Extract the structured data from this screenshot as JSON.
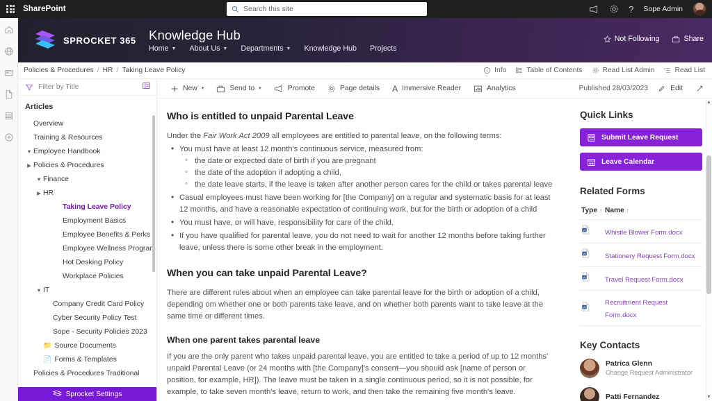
{
  "suitebar": {
    "app_name": "SharePoint",
    "search_placeholder": "Search this site",
    "user_name": "Sope Admin",
    "icons": [
      "waffle-icon",
      "megaphone-icon",
      "gear-icon",
      "help-icon",
      "avatar"
    ]
  },
  "rail": {
    "items": [
      {
        "name": "home-icon"
      },
      {
        "name": "globe-icon"
      },
      {
        "name": "news-icon"
      },
      {
        "name": "page-icon"
      },
      {
        "name": "list-icon"
      },
      {
        "name": "create-icon"
      }
    ]
  },
  "site_header": {
    "logo_text": "SPROCKET 365",
    "site_title": "Knowledge Hub",
    "nav": [
      {
        "label": "Home",
        "has_chevron": true
      },
      {
        "label": "About Us",
        "has_chevron": true
      },
      {
        "label": "Departments",
        "has_chevron": true
      },
      {
        "label": "Knowledge Hub",
        "has_chevron": false
      },
      {
        "label": "Projects",
        "has_chevron": false
      }
    ],
    "follow_label": "Not Following",
    "share_label": "Share"
  },
  "breadcrumb": {
    "items": [
      "Policies & Procedures",
      "HR",
      "Taking Leave Policy"
    ],
    "separator": "/",
    "right_commands": [
      {
        "label": "Info",
        "icon": "info-icon"
      },
      {
        "label": "Table of Contents",
        "icon": "toc-icon"
      },
      {
        "label": "Read List Admin",
        "icon": "gear-icon"
      },
      {
        "label": "Read List",
        "icon": "readlist-icon"
      }
    ]
  },
  "leftnav": {
    "filter_placeholder": "Filter by Title",
    "section_title": "Articles",
    "items": [
      {
        "label": "Overview",
        "indent": 1,
        "twisty": "",
        "selected": false
      },
      {
        "label": "Training & Resources",
        "indent": 1,
        "twisty": "",
        "selected": false
      },
      {
        "label": "Employee Handbook",
        "indent": 1,
        "twisty": "v",
        "selected": false
      },
      {
        "label": "Policies & Procedures",
        "indent": 1,
        "twisty": ">",
        "selected": false
      },
      {
        "label": "Finance",
        "indent": 2,
        "twisty": "v",
        "selected": false
      },
      {
        "label": "HR",
        "indent": 2,
        "twisty": ">",
        "selected": false
      },
      {
        "label": "Taking Leave Policy",
        "indent": 4,
        "twisty": "",
        "selected": true
      },
      {
        "label": "Employment Basics",
        "indent": 4,
        "twisty": "",
        "selected": false
      },
      {
        "label": "Employee Benefits & Perks",
        "indent": 4,
        "twisty": "",
        "selected": false
      },
      {
        "label": "Employee Wellness Program",
        "indent": 4,
        "twisty": "",
        "selected": false
      },
      {
        "label": "Hot Desking Policy",
        "indent": 4,
        "twisty": "",
        "selected": false
      },
      {
        "label": "Workplace Policies",
        "indent": 4,
        "twisty": "",
        "selected": false
      },
      {
        "label": "IT",
        "indent": 2,
        "twisty": "v",
        "selected": false
      },
      {
        "label": "Company Credit Card Policy",
        "indent": 3,
        "twisty": "",
        "selected": false
      },
      {
        "label": "Cyber Security Policy Test",
        "indent": 3,
        "twisty": "",
        "selected": false
      },
      {
        "label": "Sope - Security Policies 2023",
        "indent": 3,
        "twisty": "",
        "selected": false
      },
      {
        "label": "Source Documents",
        "indent": 2,
        "twisty": "",
        "selected": false,
        "emoji": "folder"
      },
      {
        "label": "Forms & Templates",
        "indent": 2,
        "twisty": "",
        "selected": false,
        "emoji": "doclib"
      },
      {
        "label": "Policies & Procedures Traditional",
        "indent": 1,
        "twisty": "",
        "selected": false
      }
    ],
    "footer_label": "Sprocket Settings"
  },
  "commandbar": {
    "commands": [
      {
        "label": "New",
        "icon": "plus-icon",
        "chevron": true
      },
      {
        "label": "Send to",
        "icon": "sendto-icon",
        "chevron": true
      },
      {
        "label": "Promote",
        "icon": "megaphone-icon",
        "chevron": false
      },
      {
        "label": "Page details",
        "icon": "gear-icon",
        "chevron": false
      },
      {
        "label": "Immersive Reader",
        "icon": "immersive-reader-icon",
        "chevron": false
      },
      {
        "label": "Analytics",
        "icon": "analytics-icon",
        "chevron": false
      }
    ],
    "published_label": "Published 28/03/2023",
    "edit_label": "Edit",
    "expand_icon": "expand-icon"
  },
  "article": {
    "heading1": "Who is entitled to unpaid Parental Leave",
    "intro_before": "Under the ",
    "intro_italic": "Fair Work Act 2009",
    "intro_after": " all employees are entitled to parental leave, on the following terms:",
    "bullet1": "You must have at least 12 month's continuous service, measured from:",
    "sub_bullets": [
      "the date or expected date of birth if you are pregnant",
      "the date of the adoption if adopting a child,",
      "the date leave starts, if the leave is taken after another person cares for the child or takes parental leave"
    ],
    "bullets_rest": [
      "Casual employees must have been working for [the Company] on a regular and systematic basis for at least 12 months, and have a reasonable expectation of continuing work, but for the birth or adoption of a child",
      "You must have, or will have, responsibility for care of the child.",
      "If you have qualified for parental leave, you do not need to wait for another 12 months before taking further leave, unless there is some other break in the employment."
    ],
    "heading2": "When you can take unpaid Parental Leave?",
    "para2": "There are different rules about when an employee can take parental leave for the birth or adoption of a child, depending om whether one or both parents take leave, and on whether both parents want to take leave at the same time or different times.",
    "heading3": "When one parent takes parental leave",
    "para3": "If you are the only parent who takes unpaid parental leave, you are entitled to take a period of up to 12 months' unpaid Parental Leave (or 24 months with [the Company]'s consent—you should ask [name of person or position, for example, HR]). The leave must be taken in a single continuous period, so it is not possible, for example, to take seven month's leave, return to work, and then take the remaining five month's leave."
  },
  "rightpane": {
    "quick_links_title": "Quick Links",
    "quick_links": [
      {
        "label": "Submit Leave Request",
        "icon": "form-icon"
      },
      {
        "label": "Leave Calendar",
        "icon": "calendar-icon"
      }
    ],
    "related_forms_title": "Related Forms",
    "forms_columns": [
      {
        "label": "Type",
        "sort": "↑"
      },
      {
        "label": "Name",
        "sort": "↑"
      }
    ],
    "forms": [
      {
        "type_icon": "word-doc-icon",
        "name": "Whistle Blower Form.docx"
      },
      {
        "type_icon": "word-doc-icon",
        "name": "Stationery Request Form.docx"
      },
      {
        "type_icon": "word-doc-icon",
        "name": "Travel Request Form.docx"
      },
      {
        "type_icon": "word-doc-icon",
        "name": "Recruitment Request Form.docx"
      }
    ],
    "key_contacts_title": "Key Contacts",
    "contacts": [
      {
        "name": "Patrica Glenn",
        "role": "Change Request Administrator"
      },
      {
        "name": "Patti Fernandez",
        "role": ""
      }
    ]
  },
  "colors": {
    "accent_purple": "#7719d8",
    "quicklink_purple": "#8822d8",
    "link_purple": "#8a3fd1",
    "suite_bg": "#1f1f1f"
  }
}
